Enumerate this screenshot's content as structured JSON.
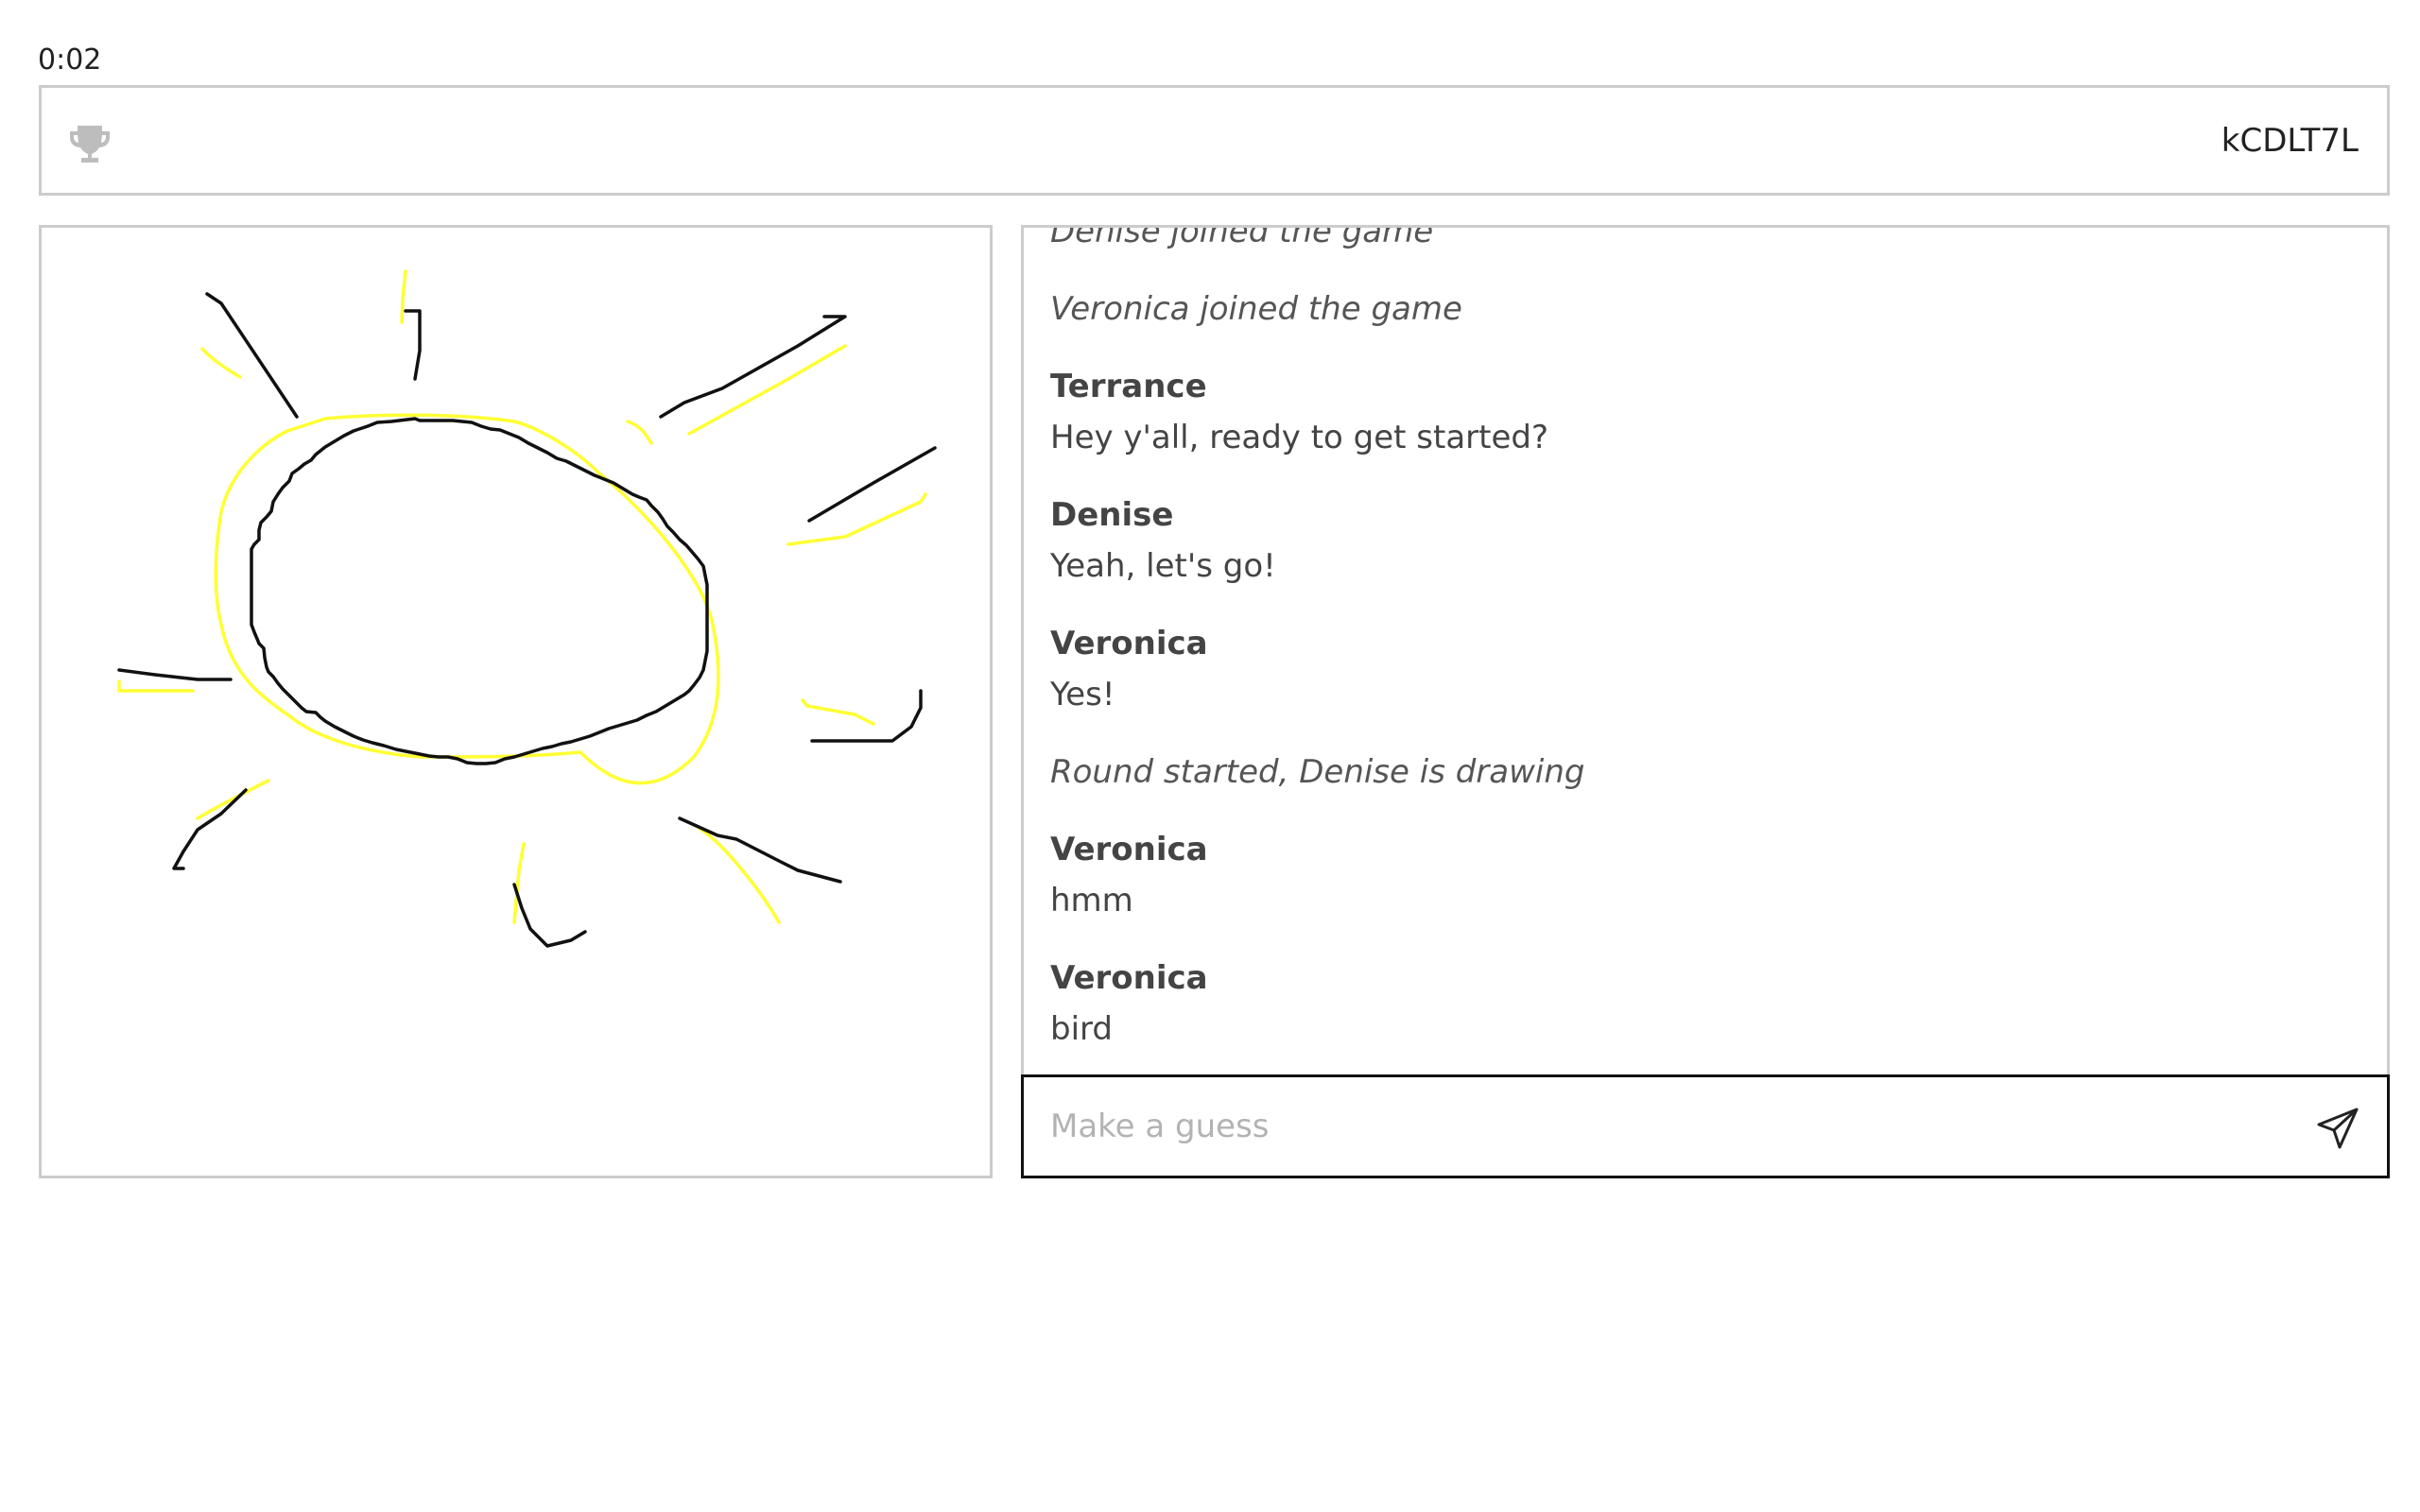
{
  "timer": "0:02",
  "header": {
    "trophy_icon": "trophy-icon",
    "room_code": "kCDLT7L"
  },
  "canvas": {
    "colors": {
      "black": "#111111",
      "yellow": "#ffff33"
    }
  },
  "chat": {
    "messages": [
      {
        "type": "system",
        "text": "Denise joined the game"
      },
      {
        "type": "system",
        "text": "Veronica joined the game"
      },
      {
        "type": "user",
        "author": "Terrance",
        "text": "Hey y'all, ready to get started?"
      },
      {
        "type": "user",
        "author": "Denise",
        "text": "Yeah, let's go!"
      },
      {
        "type": "user",
        "author": "Veronica",
        "text": "Yes!"
      },
      {
        "type": "system",
        "text": "Round started, Denise is drawing"
      },
      {
        "type": "user",
        "author": "Veronica",
        "text": "hmm"
      },
      {
        "type": "user",
        "author": "Veronica",
        "text": "bird"
      }
    ]
  },
  "guess": {
    "placeholder": "Make a guess",
    "value": "",
    "send_icon": "send-icon"
  }
}
